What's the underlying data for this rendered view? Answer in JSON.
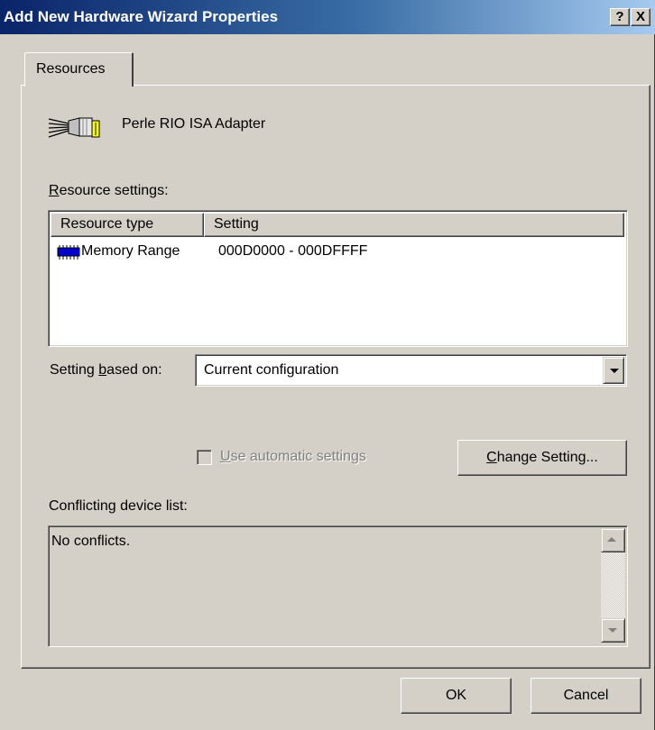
{
  "window": {
    "title": "Add New Hardware Wizard Properties",
    "help_label": "?",
    "close_label": "X"
  },
  "tabs": [
    {
      "label": "Resources",
      "selected": true
    }
  ],
  "device": {
    "name": "Perle RIO ISA Adapter",
    "icon": "serial-port-icon"
  },
  "resources": {
    "label_underlined": "R",
    "label_rest": "esource settings:",
    "columns": [
      "Resource type",
      "Setting"
    ],
    "rows": [
      {
        "type": "Memory Range",
        "setting": "000D0000 - 000DFFFF",
        "icon": "memory-chip-icon"
      }
    ]
  },
  "setting_based_on": {
    "label_pre": "Setting ",
    "label_underlined": "b",
    "label_post": "ased on:",
    "value": "Current configuration"
  },
  "auto_settings": {
    "label_underlined": "U",
    "label_rest": "se automatic settings",
    "checked": false,
    "enabled": false
  },
  "change_setting": {
    "label_underlined": "C",
    "label_rest": "hange Setting..."
  },
  "conflicts": {
    "label": "Conflicting device list:",
    "text": "No conflicts."
  },
  "buttons": {
    "ok": "OK",
    "cancel": "Cancel"
  },
  "colors": {
    "title_start": "#0a246a",
    "title_end": "#a6caf0",
    "face": "#d4d0c8",
    "memory_icon": "#0000cc"
  }
}
